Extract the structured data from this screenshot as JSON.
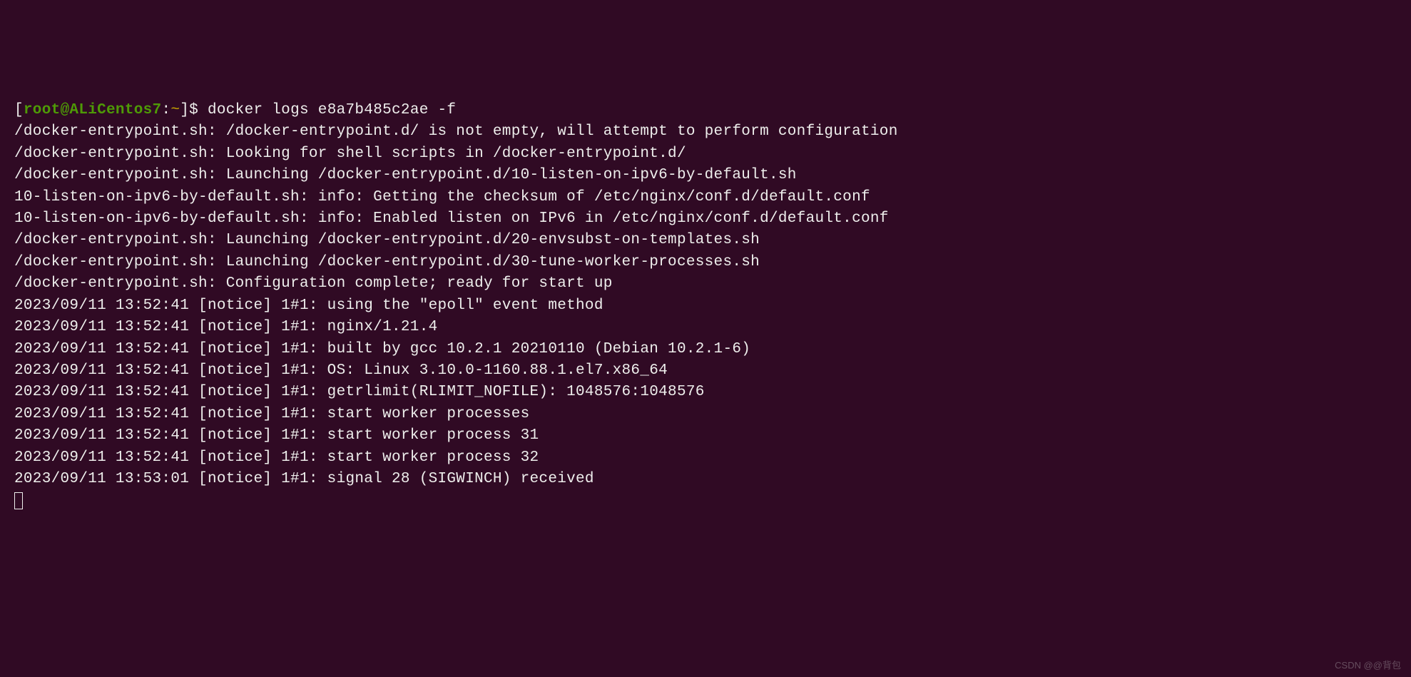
{
  "prompt": {
    "open_bracket": "[",
    "user_host": "root@ALiCentos7",
    "colon": ":",
    "tilde": "~",
    "close_bracket_dollar": "]$ "
  },
  "command": "docker logs e8a7b485c2ae -f",
  "log_lines": [
    "/docker-entrypoint.sh: /docker-entrypoint.d/ is not empty, will attempt to perform configuration",
    "/docker-entrypoint.sh: Looking for shell scripts in /docker-entrypoint.d/",
    "/docker-entrypoint.sh: Launching /docker-entrypoint.d/10-listen-on-ipv6-by-default.sh",
    "10-listen-on-ipv6-by-default.sh: info: Getting the checksum of /etc/nginx/conf.d/default.conf",
    "10-listen-on-ipv6-by-default.sh: info: Enabled listen on IPv6 in /etc/nginx/conf.d/default.conf",
    "/docker-entrypoint.sh: Launching /docker-entrypoint.d/20-envsubst-on-templates.sh",
    "/docker-entrypoint.sh: Launching /docker-entrypoint.d/30-tune-worker-processes.sh",
    "/docker-entrypoint.sh: Configuration complete; ready for start up",
    "2023/09/11 13:52:41 [notice] 1#1: using the \"epoll\" event method",
    "2023/09/11 13:52:41 [notice] 1#1: nginx/1.21.4",
    "2023/09/11 13:52:41 [notice] 1#1: built by gcc 10.2.1 20210110 (Debian 10.2.1-6)",
    "2023/09/11 13:52:41 [notice] 1#1: OS: Linux 3.10.0-1160.88.1.el7.x86_64",
    "2023/09/11 13:52:41 [notice] 1#1: getrlimit(RLIMIT_NOFILE): 1048576:1048576",
    "2023/09/11 13:52:41 [notice] 1#1: start worker processes",
    "2023/09/11 13:52:41 [notice] 1#1: start worker process 31",
    "2023/09/11 13:52:41 [notice] 1#1: start worker process 32",
    "2023/09/11 13:53:01 [notice] 1#1: signal 28 (SIGWINCH) received"
  ],
  "watermark": "CSDN @@背包"
}
